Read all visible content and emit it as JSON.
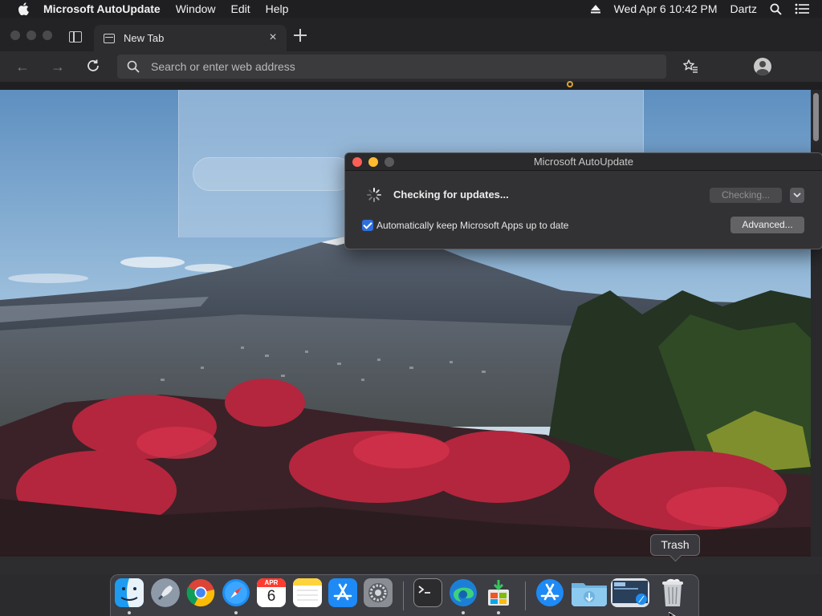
{
  "menubar": {
    "app_name": "Microsoft AutoUpdate",
    "items": [
      "Window",
      "Edit",
      "Help"
    ],
    "clock": "Wed Apr 6  10:42 PM",
    "user": "Dartz"
  },
  "browser": {
    "tab_title": "New Tab",
    "address_placeholder": "Search or enter web address"
  },
  "dialog": {
    "title": "Microsoft AutoUpdate",
    "status": "Checking for updates...",
    "checking_button": "Checking...",
    "auto_update_label": "Automatically keep Microsoft Apps up to date",
    "auto_update_checked": true,
    "advanced_button": "Advanced..."
  },
  "dock": {
    "tooltip": "Trash",
    "calendar_month": "APR",
    "calendar_day": "6",
    "apps": [
      "Finder",
      "Launchpad",
      "Google Chrome",
      "Safari",
      "Calendar",
      "Notes",
      "App Store",
      "System Preferences",
      "Terminal",
      "Microsoft Edge",
      "Microsoft AutoUpdate Installer",
      "App Store",
      "Downloads",
      "Screenshot",
      "Trash"
    ]
  },
  "colors": {
    "close": "#fe5f57",
    "minimize": "#febc2e",
    "zoom_disabled": "#5a5a5d",
    "checkbox_accent": "#2f6fdc"
  }
}
